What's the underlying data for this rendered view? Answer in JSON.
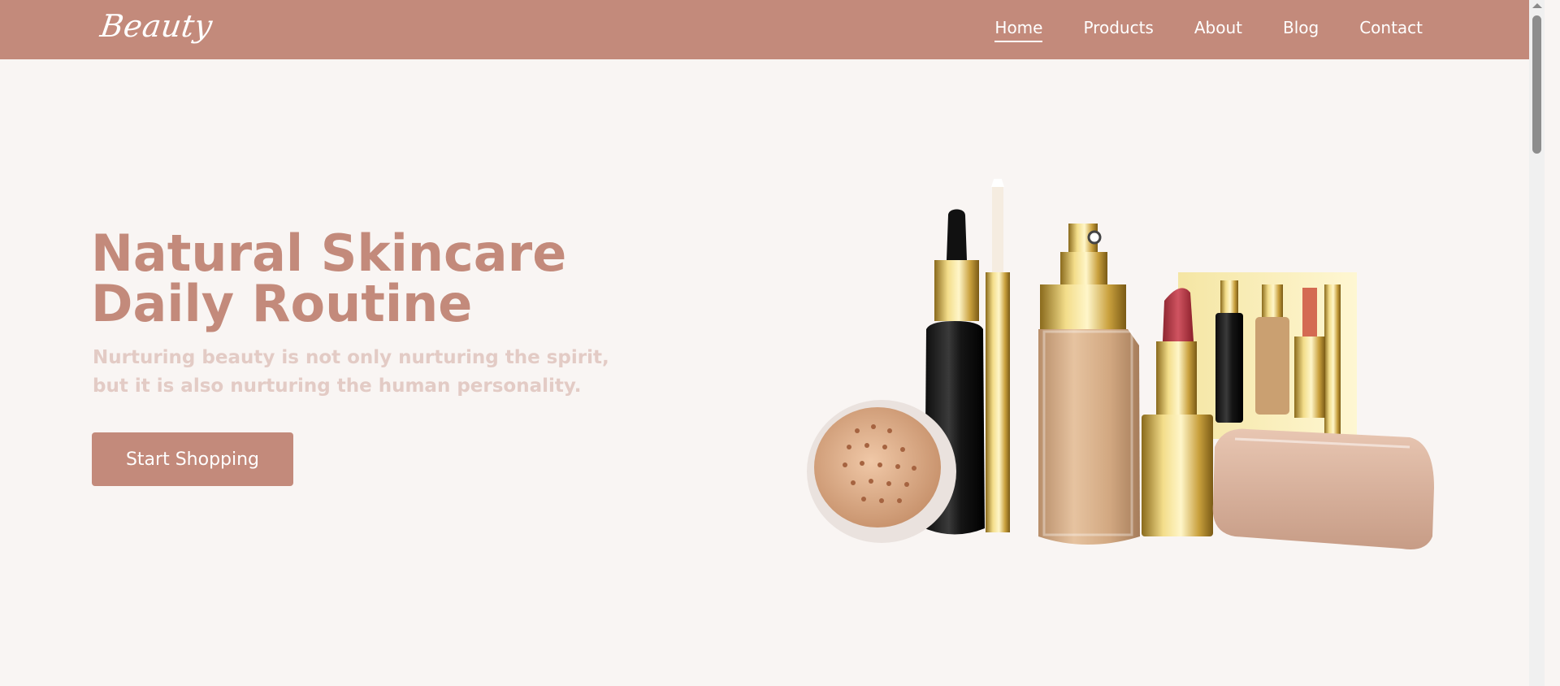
{
  "brand": {
    "logo_text": "Beauty",
    "accent": "#c38a7b",
    "subtle": "#e3cbc5",
    "background": "#f9f5f3"
  },
  "nav": {
    "items": [
      {
        "label": "Home",
        "active": true
      },
      {
        "label": "Products",
        "active": false
      },
      {
        "label": "About",
        "active": false
      },
      {
        "label": "Blog",
        "active": false
      },
      {
        "label": "Contact",
        "active": false
      }
    ]
  },
  "hero": {
    "title_lines": [
      "Natural Skincare",
      "Daily Routine"
    ],
    "subtitle_lines": [
      "Nurturing beauty is not only nurturing the spirit,",
      "but it is also nurturing the human personality."
    ],
    "cta_label": "Start Shopping"
  },
  "image": {
    "icon": "cosmetics-products-image"
  }
}
